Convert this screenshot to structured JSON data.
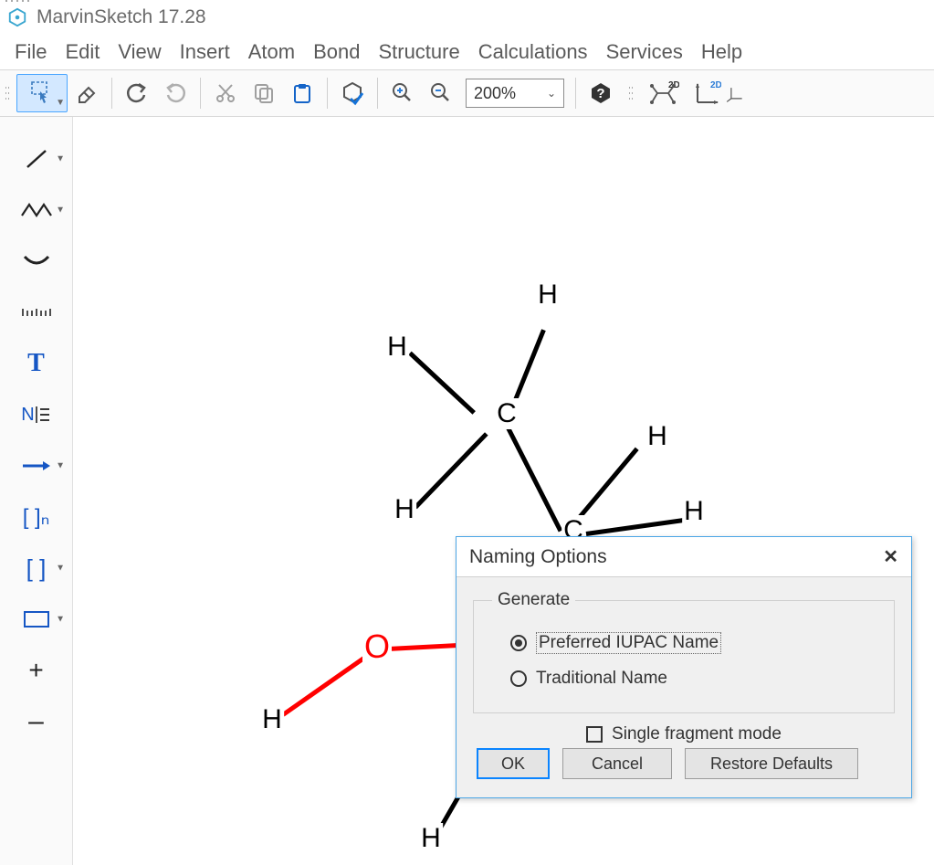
{
  "app": {
    "title": "MarvinSketch 17.28"
  },
  "menu": [
    "File",
    "Edit",
    "View",
    "Insert",
    "Atom",
    "Bond",
    "Structure",
    "Calculations",
    "Services",
    "Help"
  ],
  "toolbar": {
    "zoom_value": "200%",
    "twoD_a": "2D",
    "twoD_b": "2D"
  },
  "sidebar": {
    "text_tool": "T",
    "name_tool": "N",
    "bracket_n": "[ ]ₙ",
    "bracket": "[ ]",
    "plus": "+",
    "minus": "–"
  },
  "molecule": {
    "atoms": {
      "H_top": "H",
      "H_left_up": "H",
      "C_upper": "C",
      "H_mid": "H",
      "H_right_up": "H",
      "C_lower": "C",
      "H_right": "H",
      "O": "O",
      "H_oh": "H",
      "H_bottom": "H"
    }
  },
  "dialog": {
    "title": "Naming Options",
    "legend": "Generate",
    "opt_iupac": "Preferred IUPAC Name",
    "opt_trad": "Traditional Name",
    "single_frag": "Single fragment mode",
    "ok": "OK",
    "cancel": "Cancel",
    "restore": "Restore Defaults"
  }
}
